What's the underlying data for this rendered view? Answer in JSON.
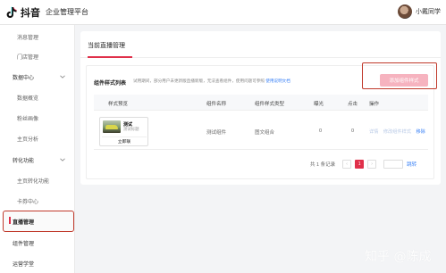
{
  "header": {
    "brand": "抖音",
    "subtitle": "企业管理平台",
    "user_name": "小戴同学"
  },
  "sidebar": {
    "items": [
      {
        "label": "消息管理",
        "kind": "child"
      },
      {
        "label": "门店管理",
        "kind": "child"
      },
      {
        "label": "数据中心",
        "kind": "group"
      },
      {
        "label": "数据概览",
        "kind": "child"
      },
      {
        "label": "粉丝画像",
        "kind": "child"
      },
      {
        "label": "主页分析",
        "kind": "child"
      },
      {
        "label": "转化功能",
        "kind": "group"
      },
      {
        "label": "主页转化功能",
        "kind": "child"
      },
      {
        "label": "卡券中心",
        "kind": "child"
      },
      {
        "label": "直播管理",
        "kind": "active"
      },
      {
        "label": "组件管理",
        "kind": "group"
      },
      {
        "label": "运营学堂",
        "kind": "group"
      }
    ]
  },
  "main": {
    "tab": "当前直播管理",
    "panel_title": "组件样式列表",
    "hint": "试用期间，部分用户未更新版直播新版，无法查看组件，使用问题可参照",
    "hint_link": "使用说明文档",
    "add_button": "添加组件样式",
    "columns": [
      "样式预览",
      "组件名称",
      "组件样式类型",
      "曝光",
      "点击",
      "操作"
    ],
    "row": {
      "preview_title": "测试",
      "preview_sub": "测试标题",
      "preview_button": "立即联",
      "name": "测试组件",
      "style_type": "图文组合",
      "exposure": "0",
      "clicks": "0",
      "op_detail": "详情",
      "op_edit": "修改组件样式",
      "op_remove": "移除"
    },
    "pager": {
      "total": "共 1 条记录",
      "prev": "‹",
      "current": "1",
      "next": "›",
      "jump": "跳转"
    }
  },
  "watermark": "知乎 @陈成",
  "colors": {
    "accent": "#e0304a",
    "button_disabled": "#f6b3bf",
    "highlight": "#c0392b",
    "link": "#3b82f6"
  }
}
